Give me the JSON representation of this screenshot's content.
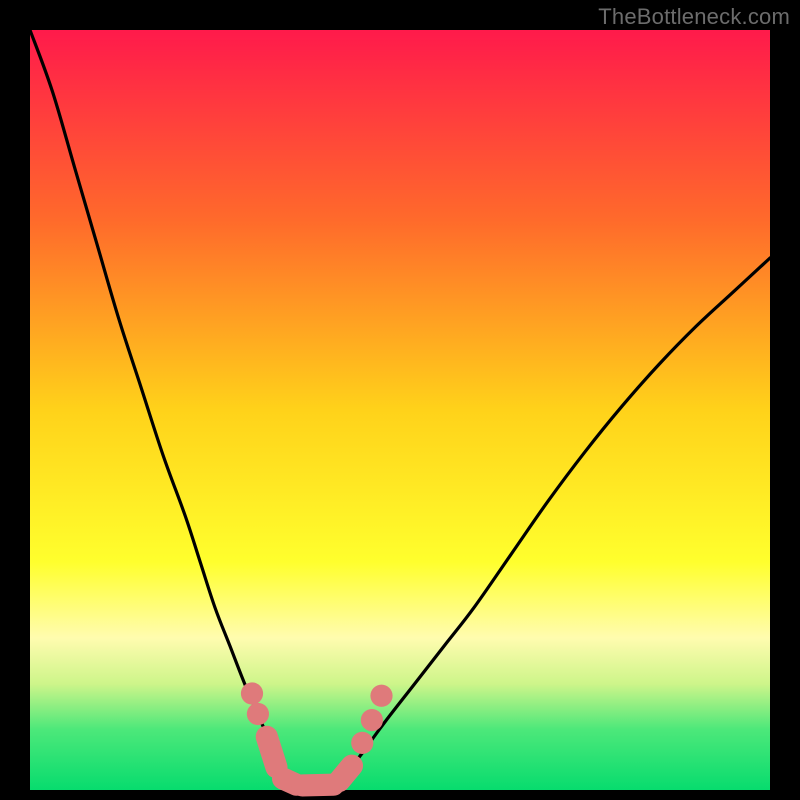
{
  "meta": {
    "watermark": "TheBottleneck.com",
    "canvas_size": 800
  },
  "chart_data": {
    "type": "line",
    "title": "",
    "xlabel": "",
    "ylabel": "",
    "xlim": [
      0,
      100
    ],
    "ylim": [
      0,
      100
    ],
    "grid": false,
    "legend": false,
    "annotations": [],
    "background_gradient": {
      "stops": [
        {
          "offset": 0.0,
          "color": "#ff1a4b"
        },
        {
          "offset": 0.25,
          "color": "#ff6a2b"
        },
        {
          "offset": 0.5,
          "color": "#ffd21a"
        },
        {
          "offset": 0.7,
          "color": "#ffff2d"
        },
        {
          "offset": 0.8,
          "color": "#fffcaf"
        },
        {
          "offset": 0.86,
          "color": "#cef58a"
        },
        {
          "offset": 0.92,
          "color": "#4de87a"
        },
        {
          "offset": 1.0,
          "color": "#07dc6e"
        }
      ]
    },
    "series": [
      {
        "name": "left-curve",
        "x": [
          0,
          3,
          6,
          9,
          12,
          15,
          18,
          21,
          23,
          25,
          27,
          29,
          31,
          33,
          34.6
        ],
        "y": [
          100,
          92,
          82,
          72,
          62,
          53,
          44,
          36,
          30,
          24,
          19,
          14,
          9.5,
          5,
          2.0
        ]
      },
      {
        "name": "right-curve",
        "x": [
          42.7,
          45,
          48,
          52,
          56,
          60,
          65,
          70,
          75,
          80,
          85,
          90,
          95,
          100
        ],
        "y": [
          2.0,
          5,
          9,
          14,
          19,
          24,
          31,
          38,
          44.5,
          50.5,
          56,
          61,
          65.5,
          70
        ]
      },
      {
        "name": "valley-floor",
        "x": [
          34.6,
          36,
          38,
          40,
          42.7
        ],
        "y": [
          2.0,
          0.9,
          0.6,
          0.9,
          2.0
        ]
      }
    ],
    "markers": {
      "color": "#df7a7b",
      "points": [
        {
          "type": "circle",
          "cx": 30.0,
          "cy": 12.7,
          "r": 1.5
        },
        {
          "type": "circle",
          "cx": 30.8,
          "cy": 10.0,
          "r": 1.5
        },
        {
          "type": "capsule",
          "x1": 32.0,
          "y1": 7.0,
          "x2": 33.3,
          "y2": 3.0,
          "width": 3.0
        },
        {
          "type": "capsule",
          "x1": 34.2,
          "y1": 1.5,
          "x2": 36.0,
          "y2": 0.7,
          "width": 3.0
        },
        {
          "type": "capsule",
          "x1": 36.8,
          "y1": 0.6,
          "x2": 41.0,
          "y2": 0.7,
          "width": 3.0
        },
        {
          "type": "capsule",
          "x1": 41.8,
          "y1": 1.2,
          "x2": 43.5,
          "y2": 3.2,
          "width": 3.0
        },
        {
          "type": "circle",
          "cx": 44.9,
          "cy": 6.2,
          "r": 1.5
        },
        {
          "type": "circle",
          "cx": 46.2,
          "cy": 9.2,
          "r": 1.5
        },
        {
          "type": "circle",
          "cx": 47.5,
          "cy": 12.4,
          "r": 1.5
        }
      ]
    }
  }
}
